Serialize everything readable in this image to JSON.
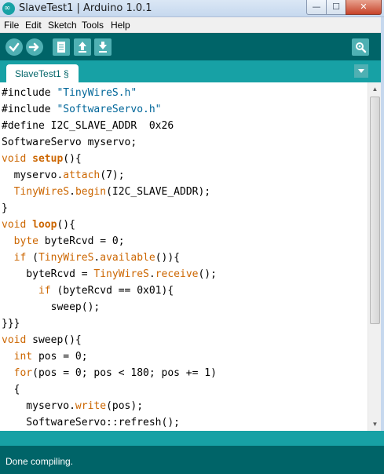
{
  "window": {
    "title": "SlaveTest1 | Arduino 1.0.1",
    "min_glyph": "—",
    "max_glyph": "☐",
    "close_glyph": "✕"
  },
  "menu": [
    "File",
    "Edit",
    "Sketch",
    "Tools",
    "Help"
  ],
  "toolbar": {
    "icons": [
      "verify-icon",
      "upload-icon",
      "new-icon",
      "open-icon",
      "save-icon",
      "serial-monitor-icon"
    ]
  },
  "tabs": {
    "active": "SlaveTest1 §",
    "menu_glyph": "▼"
  },
  "code_lines": [
    "#include \"TinyWireS.h\"",
    "#include \"SoftwareServo.h\"",
    "#define I2C_SLAVE_ADDR  0x26",
    "SoftwareServo myservo;",
    "void setup(){",
    "  myservo.attach(7);",
    "  TinyWireS.begin(I2C_SLAVE_ADDR);",
    "}",
    "void loop(){",
    "  byte byteRcvd = 0;",
    "  if (TinyWireS.available()){",
    "    byteRcvd = TinyWireS.receive();",
    "      if (byteRcvd == 0x01){",
    "        sweep();",
    "}}}",
    "void sweep(){",
    "  int pos = 0;",
    "  for(pos = 0; pos < 180; pos += 1)",
    "  {",
    "    myservo.write(pos);",
    "    SoftwareServo::refresh();"
  ],
  "status": {
    "message": "Done compiling."
  },
  "colors": {
    "toolbar": "#006468",
    "tabbar": "#17a1a5",
    "keyword": "#cc6600",
    "string": "#006699"
  }
}
